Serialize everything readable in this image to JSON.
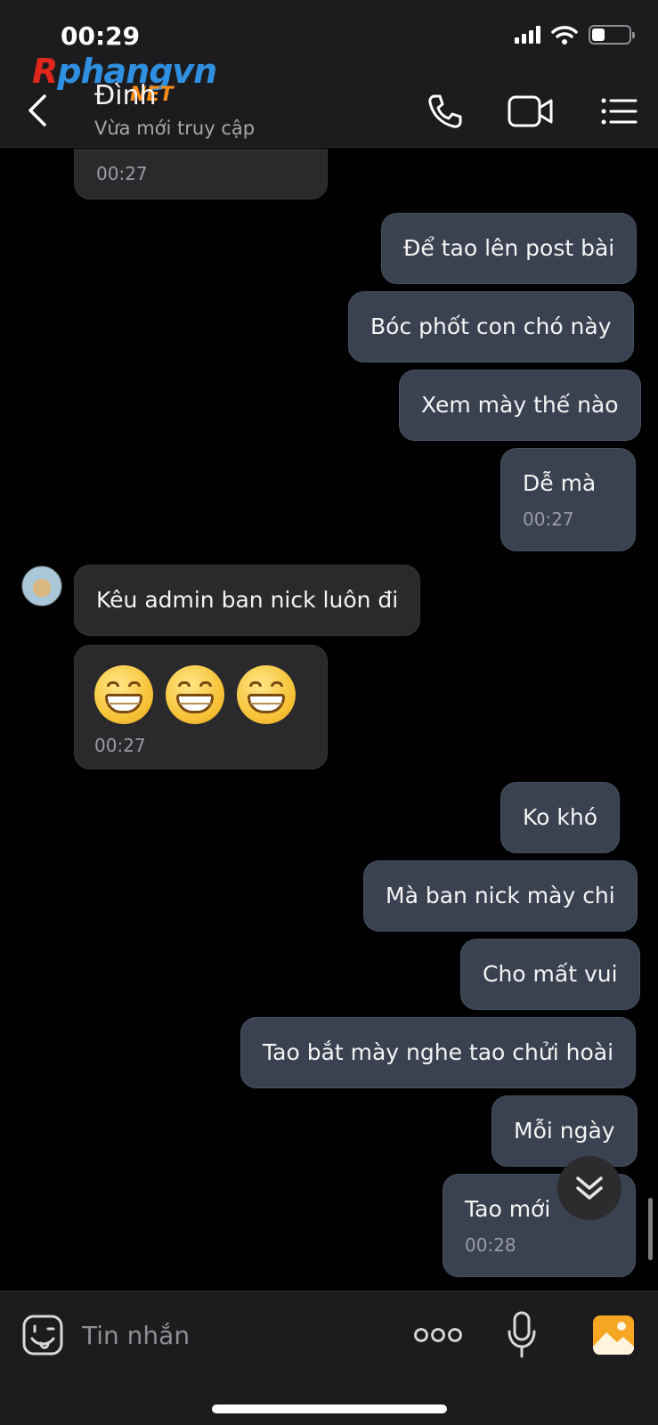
{
  "status_bar": {
    "time": "00:29",
    "battery_level": 0.35
  },
  "watermark": {
    "part1": "R",
    "part2": "phangvn",
    "part3": "NET"
  },
  "header": {
    "contact_name": "Đình",
    "contact_status": "Vừa mới truy cập",
    "icons": [
      "back-icon",
      "phone-icon",
      "video-call-icon",
      "menu-icon"
    ]
  },
  "messages": [
    {
      "side": "in",
      "type": "emoji",
      "time": "00:27"
    },
    {
      "side": "out",
      "text": "Để tao lên post bài"
    },
    {
      "side": "out",
      "text": "Bóc phốt con chó này"
    },
    {
      "side": "out",
      "text": "Xem mày thế nào"
    },
    {
      "side": "out",
      "text": "Dễ mà",
      "time": "00:27"
    },
    {
      "side": "in",
      "text": "Kêu admin ban nick luôn đi"
    },
    {
      "side": "in",
      "type": "emoji",
      "count": 3,
      "time": "00:27"
    },
    {
      "side": "out",
      "text": "Ko khó"
    },
    {
      "side": "out",
      "text": "Mà ban nick mày chi"
    },
    {
      "side": "out",
      "text": "Cho mất vui"
    },
    {
      "side": "out",
      "text": "Tao bắt mày nghe tao chửi hoài"
    },
    {
      "side": "out",
      "text": "Mỗi ngày"
    },
    {
      "side": "out",
      "text": "Tao mới",
      "time": "00:28"
    }
  ],
  "input": {
    "placeholder": "Tin nhắn",
    "value": ""
  },
  "bottom_icons": [
    "sticker-icon",
    "more-icon",
    "microphone-icon",
    "image-icon"
  ],
  "colors": {
    "outgoing_bubble": "#3a4150",
    "incoming_bubble": "#2a2a2c",
    "accent_image": "#f5a623"
  }
}
